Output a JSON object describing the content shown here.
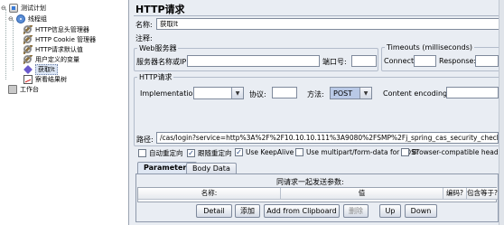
{
  "tree": {
    "items": [
      {
        "label": "测试计划",
        "icon": "test-plan-icon",
        "toggle": "⊖"
      },
      {
        "label": "线程组",
        "icon": "thread-group-icon",
        "toggle": "⊖"
      },
      {
        "label": "HTTP信息头管理器",
        "icon": "wrench-icon",
        "toggle": ""
      },
      {
        "label": "HTTP Cookie 管理器",
        "icon": "wrench-icon",
        "toggle": ""
      },
      {
        "label": "HTTP请求默认值",
        "icon": "wrench-icon",
        "toggle": ""
      },
      {
        "label": "用户定义的变量",
        "icon": "wrench-icon",
        "toggle": ""
      },
      {
        "label": "获取lt",
        "icon": "sampler-icon",
        "toggle": ""
      },
      {
        "label": "察看结果树",
        "icon": "listener-icon",
        "toggle": ""
      },
      {
        "label": "工作台",
        "icon": "workbench-icon",
        "toggle": ""
      }
    ]
  },
  "form": {
    "title": "HTTP请求",
    "name_label": "名称:",
    "name_value": "获取lt",
    "comment_label": "注释:",
    "web_server": {
      "legend": "Web服务器",
      "server_label": "服务器名称或IP:",
      "server_value": "",
      "port_label": "端口号:",
      "port_value": ""
    },
    "timeouts": {
      "legend": "Timeouts (milliseconds)",
      "connect_label": "Connect:",
      "connect_value": "",
      "response_label": "Response:",
      "response_value": ""
    },
    "http_request": {
      "legend": "HTTP请求",
      "implementation_label": "Implementation:",
      "implementation_value": "",
      "protocol_label": "协议:",
      "protocol_value": "",
      "method_label": "方法:",
      "method_value": "POST",
      "encoding_label": "Content encoding:",
      "encoding_value": "",
      "path_label": "路径:",
      "path_value": "/cas/login?service=http%3A%2F%2F10.10.10.111%3A9080%2FSMP%2Fj_spring_cas_security_check"
    },
    "checkboxes": [
      {
        "label": "自动重定向",
        "checked": false
      },
      {
        "label": "跟随重定向",
        "checked": true
      },
      {
        "label": "Use KeepAlive",
        "checked": true
      },
      {
        "label": "Use multipart/form-data for POST",
        "checked": false
      },
      {
        "label": "Browser-compatible headers",
        "checked": false
      }
    ],
    "tabs": [
      "Parameters",
      "Body Data"
    ],
    "table": {
      "caption": "同请求一起发送参数:",
      "columns": [
        "名称:",
        "值",
        "编码?",
        "包含等于?"
      ]
    },
    "buttons": {
      "detail": "Detail",
      "add": "添加",
      "add_from_clipboard": "Add from Clipboard",
      "delete": "删除",
      "up": "Up",
      "down": "Down"
    }
  },
  "colors": {
    "panel_bg": "#e9edf3",
    "method_select_bg": "#b9c9e6"
  }
}
